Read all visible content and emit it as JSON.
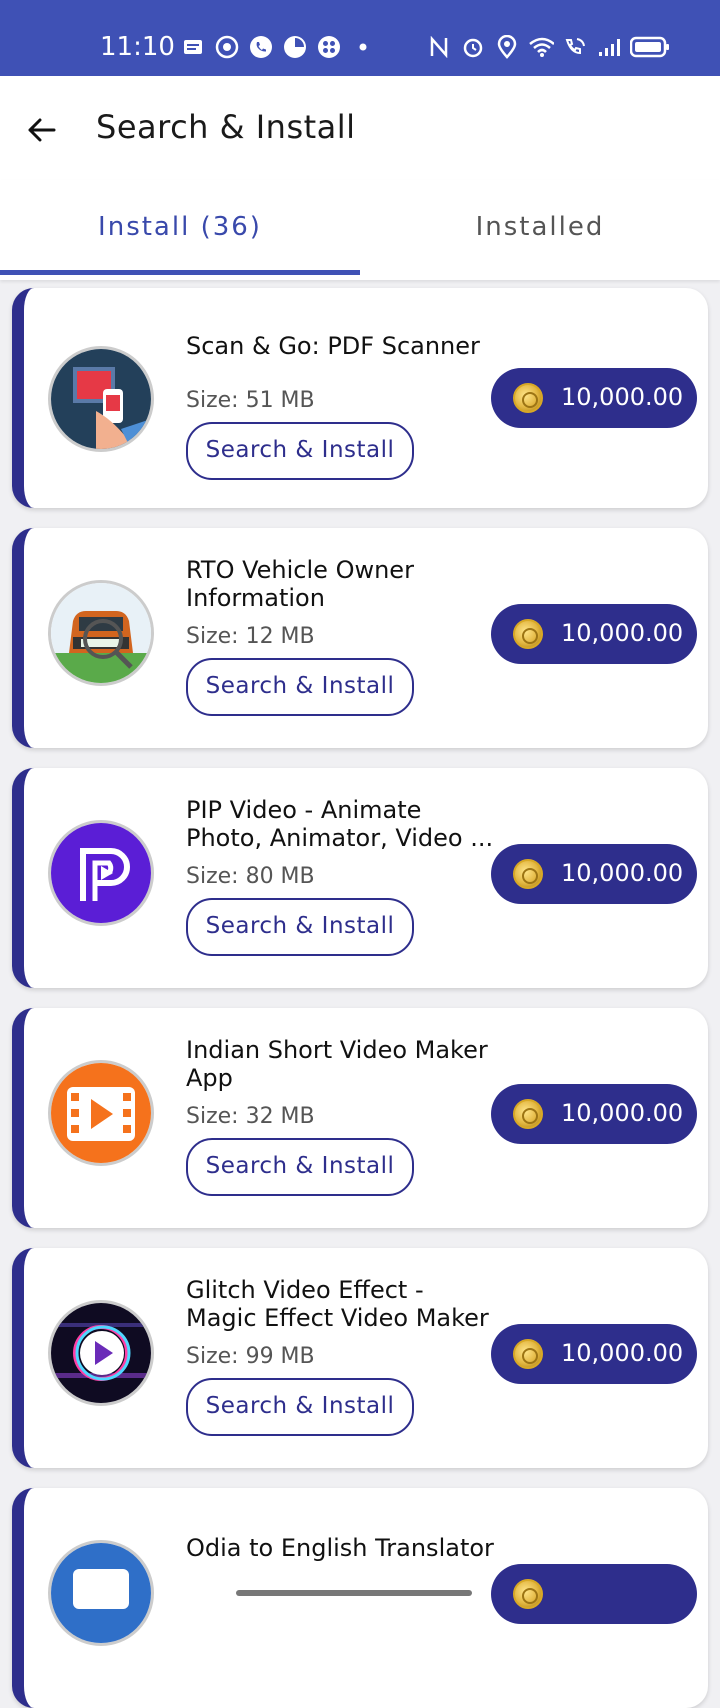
{
  "status_bar": {
    "time": "11:10"
  },
  "header": {
    "title": "Search & Install"
  },
  "tabs": [
    {
      "label": "Install (36)",
      "active": true
    },
    {
      "label": "Installed",
      "active": false
    }
  ],
  "apps": [
    {
      "name": "Scan & Go: PDF Scanner",
      "size": "Size: 51 MB",
      "button": "Search & Install",
      "reward": "10,000.00",
      "icon": "pdf-scanner-icon"
    },
    {
      "name": "RTO Vehicle Owner Information",
      "size": "Size: 12 MB",
      "button": "Search & Install",
      "reward": "10,000.00",
      "icon": "rto-vehicle-icon"
    },
    {
      "name": "PIP Video - Animate Photo, Animator, Video ...",
      "size": "Size: 80 MB",
      "button": "Search & Install",
      "reward": "10,000.00",
      "icon": "pip-video-icon"
    },
    {
      "name": "Indian Short Video Maker App",
      "size": "Size: 32 MB",
      "button": "Search & Install",
      "reward": "10,000.00",
      "icon": "video-maker-icon"
    },
    {
      "name": "Glitch Video Effect - Magic Effect Video Maker",
      "size": "Size: 99 MB",
      "button": "Search & Install",
      "reward": "10,000.00",
      "icon": "glitch-video-icon"
    },
    {
      "name": "Odia to English Translator",
      "size": "",
      "button": "",
      "reward": "",
      "icon": "translator-icon"
    }
  ],
  "colors": {
    "primary": "#3f51b5",
    "accent_dark": "#2e2e8c",
    "text": "#111111"
  }
}
